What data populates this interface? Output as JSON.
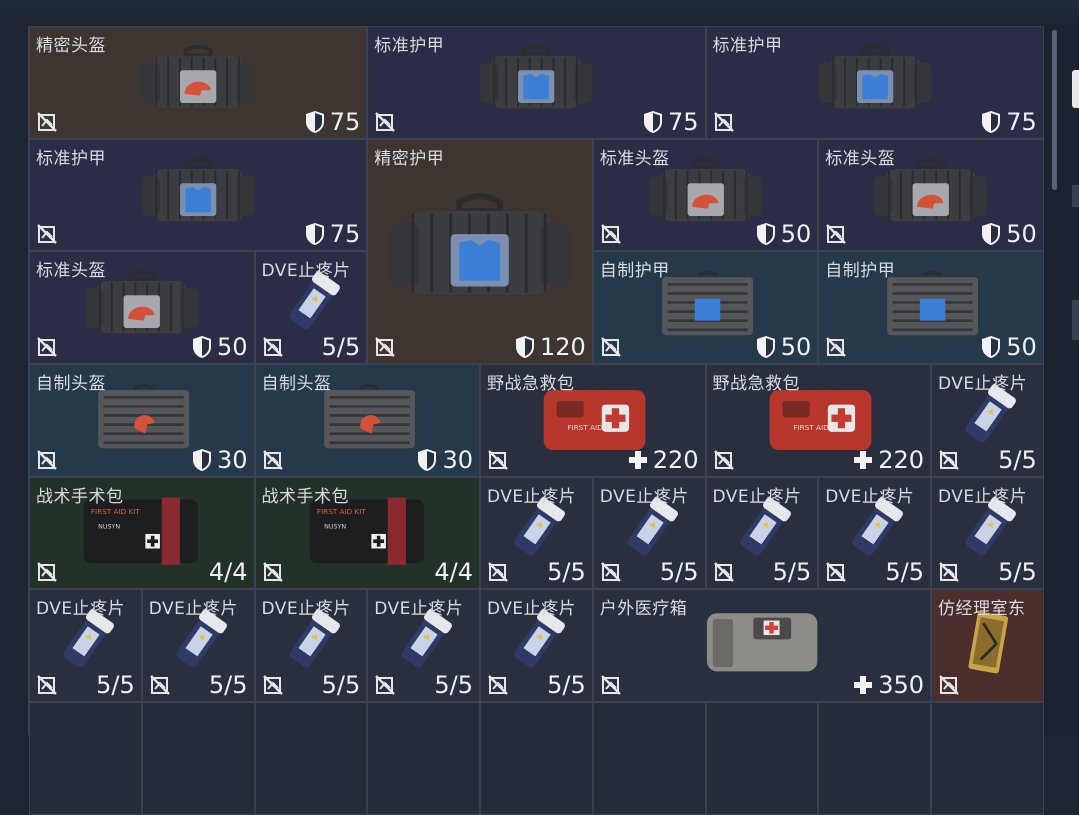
{
  "colors": {
    "cell_border": "#3a4152",
    "text": "#d8dbe2",
    "brown": "#3e3430",
    "navy": "#2a2d45",
    "teal": "#25394a",
    "green": "#233229"
  },
  "items": [
    {
      "id": "c1",
      "name": "精密头盔",
      "value": "75",
      "stat_icon": "armor-shield-icon",
      "art": "bag-helmet"
    },
    {
      "id": "c2",
      "name": "标准护甲",
      "value": "75",
      "stat_icon": "armor-shield-icon",
      "art": "bag-vest"
    },
    {
      "id": "c3",
      "name": "标准护甲",
      "value": "75",
      "stat_icon": "armor-shield-icon",
      "art": "bag-vest"
    },
    {
      "id": "c4",
      "name": "标准护甲",
      "value": "75",
      "stat_icon": "armor-shield-icon",
      "art": "bag-vest"
    },
    {
      "id": "c5",
      "name": "精密护甲",
      "value": "120",
      "stat_icon": "armor-shield-icon",
      "art": "bag-vest-large"
    },
    {
      "id": "c6",
      "name": "标准头盔",
      "value": "50",
      "stat_icon": "armor-shield-icon",
      "art": "bag-helmet"
    },
    {
      "id": "c7",
      "name": "标准头盔",
      "value": "50",
      "stat_icon": "armor-shield-icon",
      "art": "bag-helmet"
    },
    {
      "id": "c8",
      "name": "标准头盔",
      "value": "50",
      "stat_icon": "armor-shield-icon",
      "art": "bag-helmet"
    },
    {
      "id": "c9",
      "name": "DVE止疼片",
      "value": "5/5",
      "stat_icon": "",
      "art": "pill"
    },
    {
      "id": "c10",
      "name": "自制护甲",
      "value": "50",
      "stat_icon": "armor-shield-icon",
      "art": "case-vest"
    },
    {
      "id": "c11",
      "name": "自制护甲",
      "value": "50",
      "stat_icon": "armor-shield-icon",
      "art": "case-vest"
    },
    {
      "id": "c12",
      "name": "自制头盔",
      "value": "30",
      "stat_icon": "armor-shield-icon",
      "art": "case-helmet"
    },
    {
      "id": "c13",
      "name": "自制头盔",
      "value": "30",
      "stat_icon": "armor-shield-icon",
      "art": "case-helmet"
    },
    {
      "id": "c14",
      "name": "野战急救包",
      "value": "220",
      "stat_icon": "heal-cross-icon",
      "art": "red-kit"
    },
    {
      "id": "c15",
      "name": "野战急救包",
      "value": "220",
      "stat_icon": "heal-cross-icon",
      "art": "red-kit"
    },
    {
      "id": "c16",
      "name": "DVE止疼片",
      "value": "5/5",
      "stat_icon": "",
      "art": "pill"
    },
    {
      "id": "c17",
      "name": "战术手术包",
      "value": "4/4",
      "stat_icon": "",
      "art": "surgical-kit"
    },
    {
      "id": "c18",
      "name": "战术手术包",
      "value": "4/4",
      "stat_icon": "",
      "art": "surgical-kit"
    },
    {
      "id": "c19",
      "name": "DVE止疼片",
      "value": "5/5",
      "stat_icon": "",
      "art": "pill"
    },
    {
      "id": "c20",
      "name": "DVE止疼片",
      "value": "5/5",
      "stat_icon": "",
      "art": "pill"
    },
    {
      "id": "c21",
      "name": "DVE止疼片",
      "value": "5/5",
      "stat_icon": "",
      "art": "pill"
    },
    {
      "id": "c22",
      "name": "DVE止疼片",
      "value": "5/5",
      "stat_icon": "",
      "art": "pill"
    },
    {
      "id": "c23",
      "name": "DVE止疼片",
      "value": "5/5",
      "stat_icon": "",
      "art": "pill"
    },
    {
      "id": "c24",
      "name": "DVE止疼片",
      "value": "5/5",
      "stat_icon": "",
      "art": "pill"
    },
    {
      "id": "c25",
      "name": "DVE止疼片",
      "value": "5/5",
      "stat_icon": "",
      "art": "pill"
    },
    {
      "id": "c26",
      "name": "DVE止疼片",
      "value": "5/5",
      "stat_icon": "",
      "art": "pill"
    },
    {
      "id": "c27",
      "name": "DVE止疼片",
      "value": "5/5",
      "stat_icon": "",
      "art": "pill"
    },
    {
      "id": "c28",
      "name": "DVE止疼片",
      "value": "5/5",
      "stat_icon": "",
      "art": "pill"
    },
    {
      "id": "c29",
      "name": "户外医疗箱",
      "value": "350",
      "stat_icon": "heal-cross-icon",
      "art": "outdoor-kit"
    },
    {
      "id": "c30",
      "name": "仿经理室东",
      "value": "",
      "stat_icon": "",
      "art": "keycard"
    }
  ],
  "art_labels": {
    "first_aid": "FIRST AID",
    "first_aid_kit": "FIRST AID KIT",
    "nusyn": "NUSYN"
  }
}
